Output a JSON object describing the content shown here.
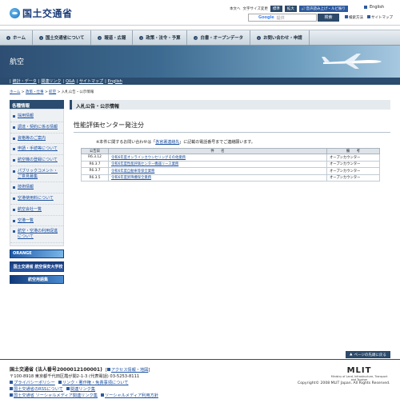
{
  "header": {
    "logo_text": "国土交通省",
    "util": {
      "text_only": "本文へ",
      "font_size_label": "文字サイズ変更",
      "font_standard": "標準",
      "font_large": "拡大",
      "voice": "音声読み上げ・ルビ振り",
      "english": "English"
    },
    "search": {
      "brand": "Google",
      "placeholder": "提供",
      "button": "検索"
    },
    "search_method": "検索方法",
    "sitemap": "サイトマップ"
  },
  "nav": {
    "items": [
      {
        "label": "ホーム"
      },
      {
        "label": "国土交通省について"
      },
      {
        "label": "報道・広報"
      },
      {
        "label": "政策・法令・予算"
      },
      {
        "label": "白書・オープンデータ"
      },
      {
        "label": "お問い合わせ・申請"
      }
    ]
  },
  "banner": {
    "title": "航空"
  },
  "subnav": {
    "items": [
      "統計・データ",
      "関連リンク",
      "Q&A",
      "サイトマップ",
      "English"
    ]
  },
  "breadcrumb": {
    "home": "ホーム",
    "sep1": " > ",
    "c1": "政策・仕事",
    "sep2": " > ",
    "c2": "航空",
    "sep3": " > ",
    "current": "入札公告・公示情報"
  },
  "sidebar": {
    "title": "各種情報",
    "items": [
      {
        "label": "採用情報"
      },
      {
        "label": "調達・契約に係る情報"
      },
      {
        "label": "資格等のご案内"
      },
      {
        "label": "申請・手続等について"
      },
      {
        "label": "航空機の登録について"
      },
      {
        "label": "パブリックコメント・ご意見募集"
      },
      {
        "label": "技術情報"
      },
      {
        "label": "空港使用料について"
      },
      {
        "label": "航空会社一覧"
      },
      {
        "label": "空港一覧"
      },
      {
        "label": "航空・空港の利用促進について"
      }
    ],
    "banners": [
      "ORANGE",
      "国土交通省 航空保安大学校",
      "航空用語集"
    ]
  },
  "main": {
    "section_title": "入札公告・公示情報",
    "page_title": "性能評価センター発注分",
    "note_prefix": "※本件に関するお問い合わせは「",
    "note_link": "各官署連絡先",
    "note_suffix": "」に記載の電話番号までご連絡願います。",
    "table": {
      "headers": [
        "公告日",
        "件　　名",
        "備　　考"
      ],
      "rows": [
        {
          "date": "R6.3.12",
          "name": "令和6年度オンラインカウンセリングその他業務",
          "remark": "オープンカウンター"
        },
        {
          "date": "R6.3.7",
          "name": "令和6年度性能評価センター機器リース業務",
          "remark": "オープンカウンター"
        },
        {
          "date": "R6.3.7",
          "name": "令和6年度自動車等保全業務",
          "remark": "オープンカウンター"
        },
        {
          "date": "R6.3.5",
          "name": "令和6年度昇降機保全業務",
          "remark": "オープンカウンター"
        }
      ]
    }
  },
  "footer": {
    "to_top": "ページの先頭に戻る",
    "org": "国土交通省 (法人番号2000012100001)",
    "access": "アクセス情報・地図",
    "address": "〒100-8918 東京都千代田区霞が関2-1-3 (代表電話) 03-5253-8111",
    "links": [
      [
        "プライバシーポリシー",
        "リンク・著作権・免責事項について"
      ],
      [
        "国土交通省のRSSについて",
        "関連リンク集"
      ],
      [
        "国土交通省 ソーシャルメディア関連リンク集",
        "ソーシャルメディア利用方針"
      ]
    ],
    "mlit_logo": "MLIT",
    "mlit_sub": "Ministry of Land, Infrastructure, Transport and Tourism",
    "copyright": "Copyright© 2008 MLIT Japan. All Rights Reserved."
  }
}
